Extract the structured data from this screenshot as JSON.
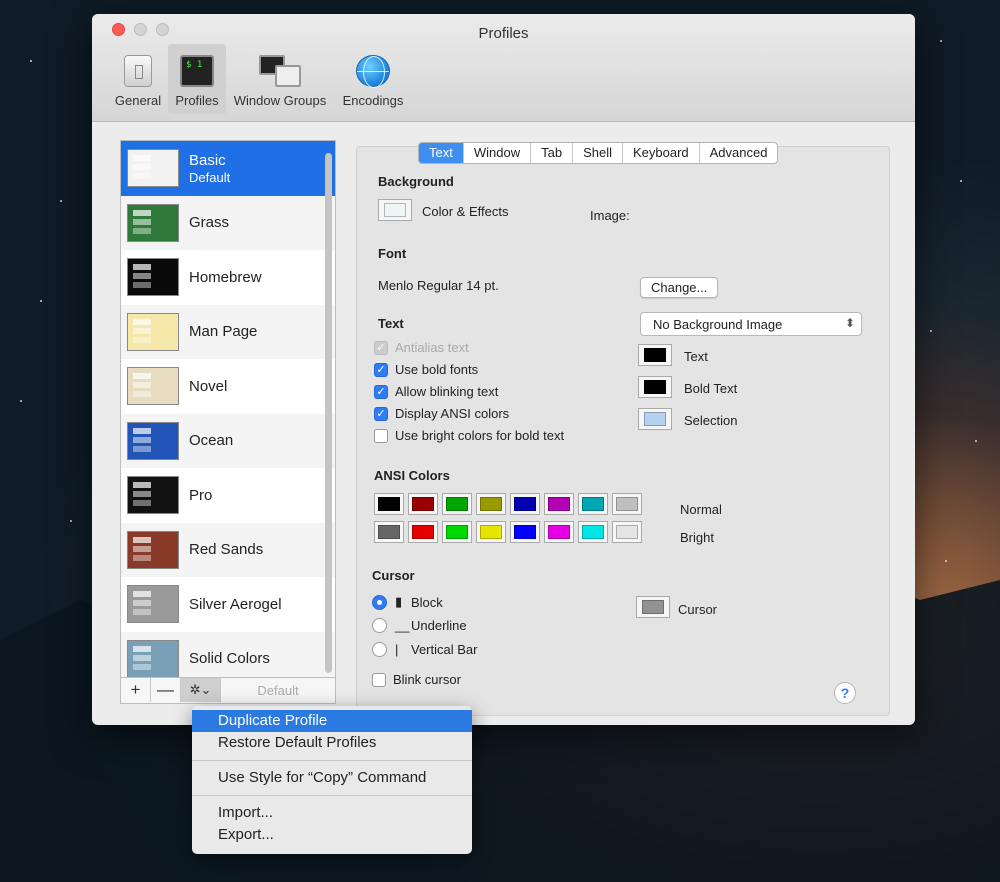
{
  "window": {
    "title": "Profiles"
  },
  "toolbar": [
    {
      "label": "General",
      "icon": "general-switch-icon",
      "selected": false
    },
    {
      "label": "Profiles",
      "icon": "terminal-profile-icon",
      "selected": true
    },
    {
      "label": "Window Groups",
      "icon": "window-groups-icon",
      "selected": false
    },
    {
      "label": "Encodings",
      "icon": "globe-icon",
      "selected": false
    }
  ],
  "profiles": [
    {
      "name": "Basic",
      "sub": "Default",
      "color": "#f2f2f2",
      "selected": true
    },
    {
      "name": "Grass",
      "sub": "",
      "color": "#2f7a3a"
    },
    {
      "name": "Homebrew",
      "sub": "",
      "color": "#0a0a0a"
    },
    {
      "name": "Man Page",
      "sub": "",
      "color": "#f5e8a8"
    },
    {
      "name": "Novel",
      "sub": "",
      "color": "#e8dcc0"
    },
    {
      "name": "Ocean",
      "sub": "",
      "color": "#2355b8"
    },
    {
      "name": "Pro",
      "sub": "",
      "color": "#111111"
    },
    {
      "name": "Red Sands",
      "sub": "",
      "color": "#8a3a28"
    },
    {
      "name": "Silver Aerogel",
      "sub": "",
      "color": "#9a9a9a"
    },
    {
      "name": "Solid Colors",
      "sub": "",
      "color": "#7aa0b8"
    }
  ],
  "bottombar": {
    "add": "+",
    "remove": "—",
    "gear": "✲⌄",
    "default": "Default"
  },
  "tabs": [
    {
      "label": "Text",
      "selected": true
    },
    {
      "label": "Window"
    },
    {
      "label": "Tab"
    },
    {
      "label": "Shell"
    },
    {
      "label": "Keyboard"
    },
    {
      "label": "Advanced"
    }
  ],
  "background": {
    "heading": "Background",
    "color_label": "Color & Effects",
    "image_label": "Image:",
    "image_value": "No Background Image"
  },
  "font": {
    "heading": "Font",
    "value": "Menlo Regular 14 pt.",
    "change": "Change..."
  },
  "text": {
    "heading": "Text",
    "options": [
      {
        "label": "Antialias text",
        "checked": true,
        "disabled": true
      },
      {
        "label": "Use bold fonts",
        "checked": true
      },
      {
        "label": "Allow blinking text",
        "checked": true
      },
      {
        "label": "Display ANSI colors",
        "checked": true
      },
      {
        "label": "Use bright colors for bold text",
        "checked": false
      }
    ],
    "colors": [
      {
        "label": "Text",
        "color": "#000000"
      },
      {
        "label": "Bold Text",
        "color": "#000000"
      },
      {
        "label": "Selection",
        "color": "#b4d2f0"
      }
    ]
  },
  "ansi": {
    "heading": "ANSI Colors",
    "normal_label": "Normal",
    "bright_label": "Bright",
    "normal": [
      "#000000",
      "#990000",
      "#00a600",
      "#999900",
      "#0000b2",
      "#b200b2",
      "#00a6b2",
      "#bfbfbf"
    ],
    "bright": [
      "#666666",
      "#e50000",
      "#00d900",
      "#e5e500",
      "#0000ff",
      "#e500e5",
      "#00e5e5",
      "#e5e5e5"
    ]
  },
  "cursor": {
    "heading": "Cursor",
    "options": [
      {
        "label": "Block",
        "glyph": "▮",
        "selected": true
      },
      {
        "label": "Underline",
        "glyph": "__",
        "selected": false
      },
      {
        "label": "Vertical Bar",
        "glyph": "|",
        "selected": false
      }
    ],
    "blink_label": "Blink cursor",
    "color_label": "Cursor",
    "color": "#929292"
  },
  "help": "?",
  "menu": {
    "items": [
      "Duplicate Profile",
      "Restore Default Profiles",
      "Use Style for “Copy” Command",
      "Import...",
      "Export..."
    ]
  }
}
